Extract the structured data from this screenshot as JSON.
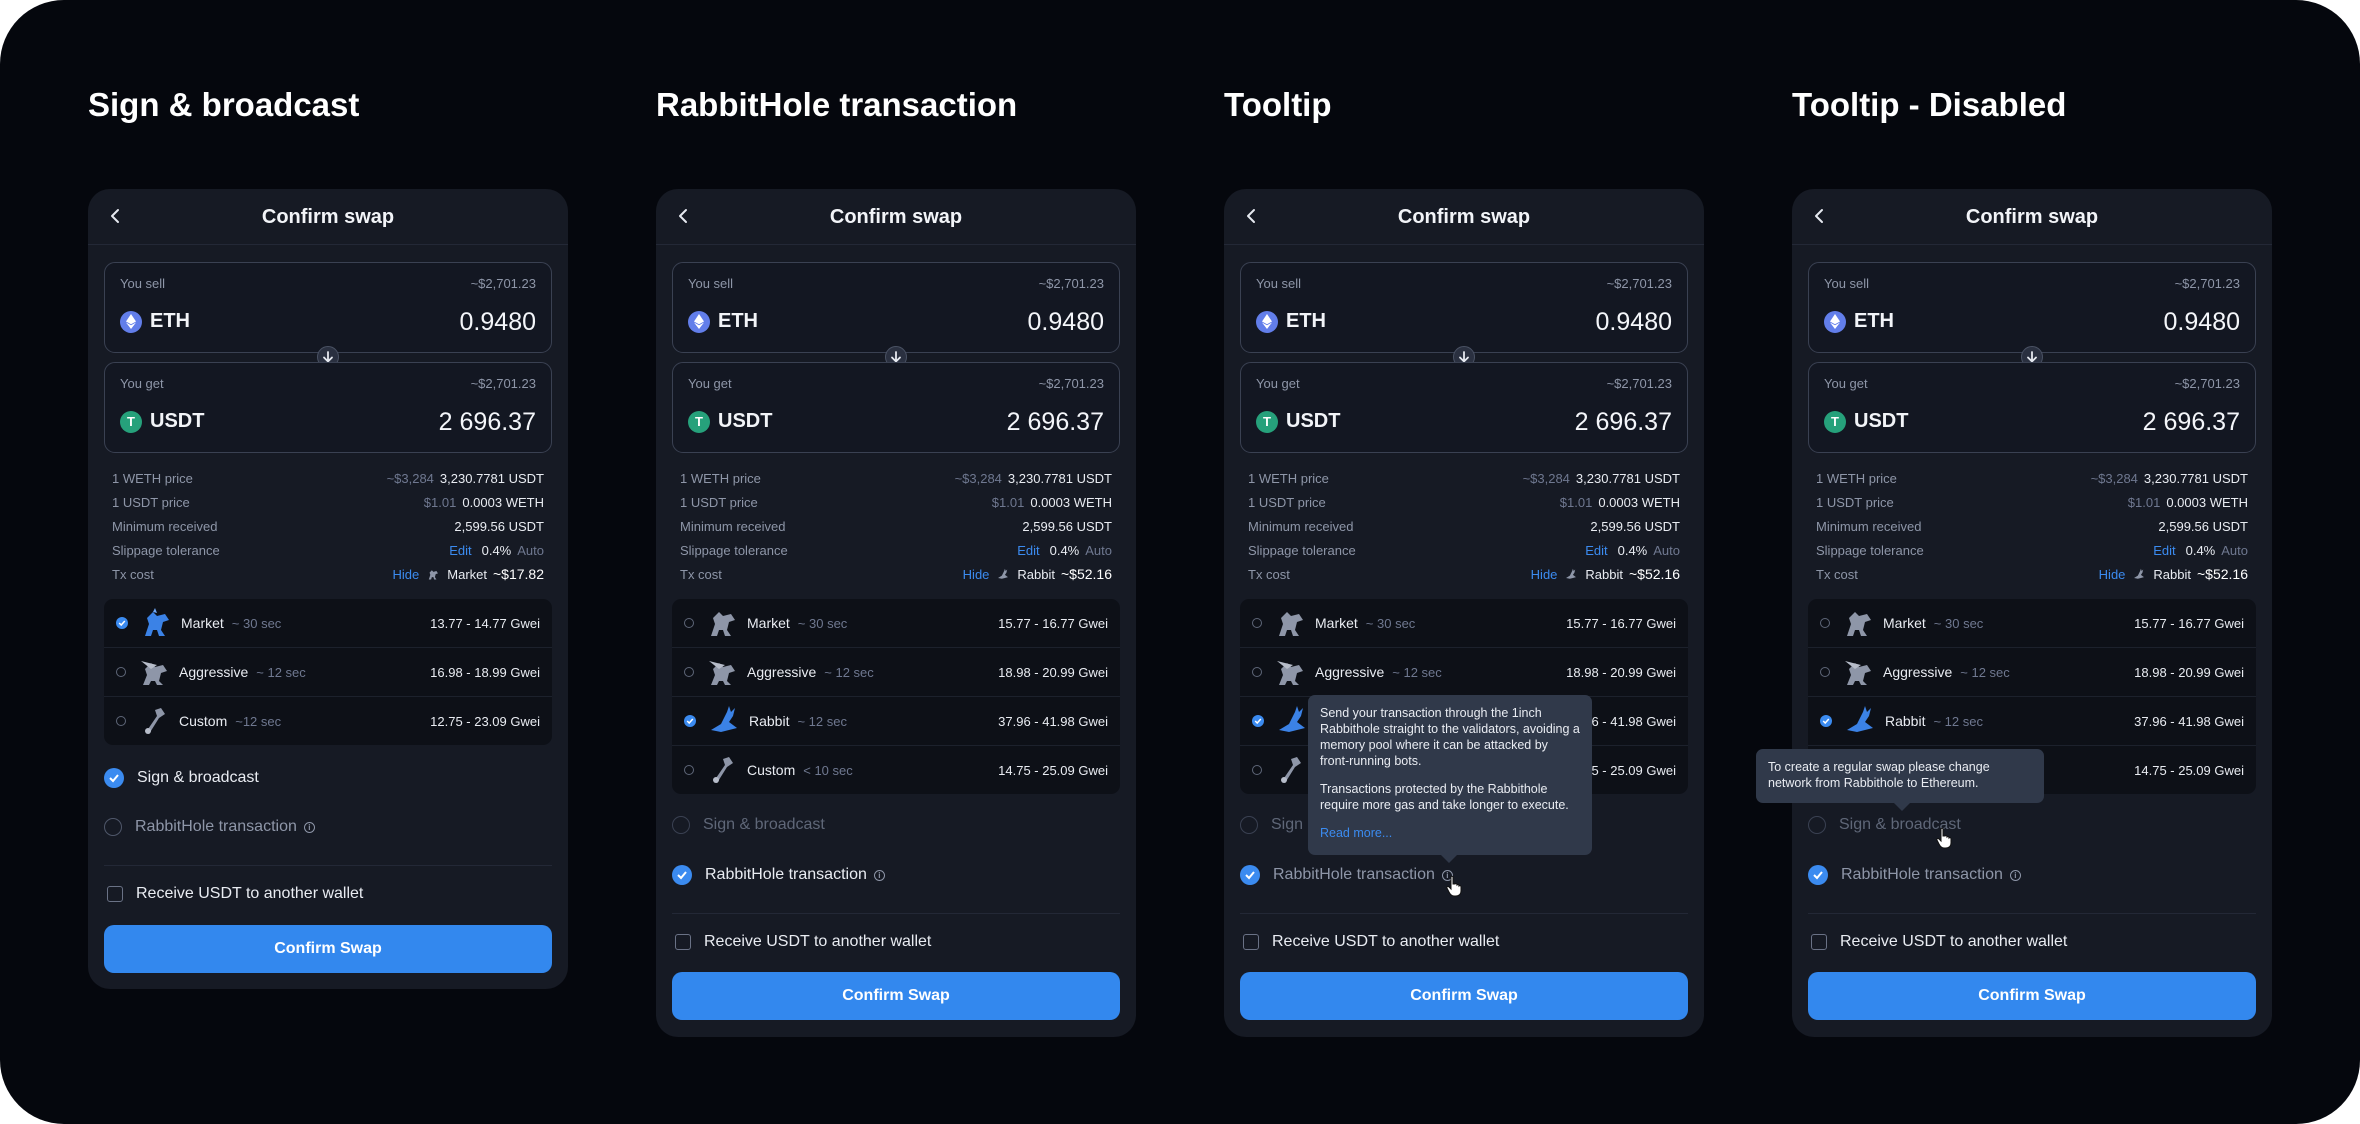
{
  "columns": [
    {
      "title": "Sign & broadcast",
      "header_title": "Confirm swap",
      "sell": {
        "label": "You sell",
        "usd": "~$2,701.23",
        "token": "ETH",
        "amount": "0.9480"
      },
      "get": {
        "label": "You get",
        "usd": "~$2,701.23",
        "token": "USDT",
        "amount": "2 696.37"
      },
      "details": {
        "weth_label": "1 WETH price",
        "weth_usd": "~$3,284",
        "weth_val": "3,230.7781 USDT",
        "usdt_label": "1 USDT price",
        "usdt_usd": "$1.01",
        "usdt_val": "0.0003 WETH",
        "min_label": "Minimum received",
        "min_val": "2,599.56 USDT",
        "slip_label": "Slippage tolerance",
        "slip_edit": "Edit",
        "slip_val": "0.4%",
        "slip_auto": "Auto",
        "tx_label": "Tx cost",
        "tx_hide": "Hide",
        "tx_mode": "Market",
        "tx_val": "~$17.82"
      },
      "gas": [
        {
          "name": "Market",
          "time": "~ 30 sec",
          "price": "13.77 - 14.77 Gwei",
          "selected": true,
          "icon": "horse-icon"
        },
        {
          "name": "Aggressive",
          "time": "~ 12 sec",
          "price": "16.98 - 18.99 Gwei",
          "selected": false,
          "icon": "pegasus-icon"
        },
        {
          "name": "Custom",
          "time": "~12 sec",
          "price": "12.75 - 23.09 Gwei",
          "selected": false,
          "icon": "wrench-icon"
        }
      ],
      "option_sign": "Sign & broadcast",
      "option_rabbit": "RabbitHole transaction",
      "receive_label": "Receive USDT to another wallet",
      "cta": "Confirm Swap"
    },
    {
      "title": "RabbitHole transaction",
      "header_title": "Confirm swap",
      "sell": {
        "label": "You sell",
        "usd": "~$2,701.23",
        "token": "ETH",
        "amount": "0.9480"
      },
      "get": {
        "label": "You get",
        "usd": "~$2,701.23",
        "token": "USDT",
        "amount": "2 696.37"
      },
      "details": {
        "weth_label": "1 WETH price",
        "weth_usd": "~$3,284",
        "weth_val": "3,230.7781 USDT",
        "usdt_label": "1 USDT price",
        "usdt_usd": "$1.01",
        "usdt_val": "0.0003 WETH",
        "min_label": "Minimum received",
        "min_val": "2,599.56 USDT",
        "slip_label": "Slippage tolerance",
        "slip_edit": "Edit",
        "slip_val": "0.4%",
        "slip_auto": "Auto",
        "tx_label": "Tx cost",
        "tx_hide": "Hide",
        "tx_mode": "Rabbit",
        "tx_val": "~$52.16"
      },
      "gas": [
        {
          "name": "Market",
          "time": "~ 30 sec",
          "price": "15.77 - 16.77 Gwei",
          "selected": false,
          "icon": "horse-icon"
        },
        {
          "name": "Aggressive",
          "time": "~ 12 sec",
          "price": "18.98 - 20.99 Gwei",
          "selected": false,
          "icon": "pegasus-icon"
        },
        {
          "name": "Rabbit",
          "time": "~ 12 sec",
          "price": "37.96 - 41.98 Gwei",
          "selected": true,
          "icon": "rabbit-icon"
        },
        {
          "name": "Custom",
          "time": "< 10 sec",
          "price": "14.75 - 25.09 Gwei",
          "selected": false,
          "icon": "wrench-icon"
        }
      ],
      "option_sign": "Sign & broadcast",
      "option_rabbit": "RabbitHole transaction",
      "receive_label": "Receive USDT to another wallet",
      "cta": "Confirm Swap"
    },
    {
      "title": "Tooltip",
      "header_title": "Confirm swap",
      "sell": {
        "label": "You sell",
        "usd": "~$2,701.23",
        "token": "ETH",
        "amount": "0.9480"
      },
      "get": {
        "label": "You get",
        "usd": "~$2,701.23",
        "token": "USDT",
        "amount": "2 696.37"
      },
      "details": {
        "weth_label": "1 WETH price",
        "weth_usd": "~$3,284",
        "weth_val": "3,230.7781 USDT",
        "usdt_label": "1 USDT price",
        "usdt_usd": "$1.01",
        "usdt_val": "0.0003 WETH",
        "min_label": "Minimum received",
        "min_val": "2,599.56 USDT",
        "slip_label": "Slippage tolerance",
        "slip_edit": "Edit",
        "slip_val": "0.4%",
        "slip_auto": "Auto",
        "tx_label": "Tx cost",
        "tx_hide": "Hide",
        "tx_mode": "Rabbit",
        "tx_val": "~$52.16"
      },
      "gas": [
        {
          "name": "Market",
          "time": "~ 30 sec",
          "price": "15.77 - 16.77 Gwei",
          "selected": false,
          "icon": "horse-icon"
        },
        {
          "name": "Aggressive",
          "time": "~ 12 sec",
          "price": "18.98 - 20.99 Gwei",
          "selected": false,
          "icon": "pegasus-icon"
        },
        {
          "name": "",
          "time": "",
          "price": "6 - 41.98 Gwei",
          "selected": true,
          "icon": "rabbit-icon"
        },
        {
          "name": "",
          "time": "",
          "price": "5 - 25.09 Gwei",
          "selected": false,
          "icon": "wrench-icon"
        }
      ],
      "option_sign": "Sign",
      "option_rabbit": "RabbitHole transaction",
      "receive_label": "Receive USDT to another wallet",
      "cta": "Confirm Swap",
      "tooltip": {
        "p1": "Send your transaction through the 1inch Rabbithole straight to the validators, avoiding a memory pool where it can be attacked by front-running bots.",
        "p2": "Transactions protected by the Rabbithole require more gas and take longer to execute.",
        "read_more": "Read more..."
      }
    },
    {
      "title": "Tooltip - Disabled",
      "header_title": "Confirm swap",
      "sell": {
        "label": "You sell",
        "usd": "~$2,701.23",
        "token": "ETH",
        "amount": "0.9480"
      },
      "get": {
        "label": "You get",
        "usd": "~$2,701.23",
        "token": "USDT",
        "amount": "2 696.37"
      },
      "details": {
        "weth_label": "1 WETH price",
        "weth_usd": "~$3,284",
        "weth_val": "3,230.7781 USDT",
        "usdt_label": "1 USDT price",
        "usdt_usd": "$1.01",
        "usdt_val": "0.0003 WETH",
        "min_label": "Minimum received",
        "min_val": "2,599.56 USDT",
        "slip_label": "Slippage tolerance",
        "slip_edit": "Edit",
        "slip_val": "0.4%",
        "slip_auto": "Auto",
        "tx_label": "Tx cost",
        "tx_hide": "Hide",
        "tx_mode": "Rabbit",
        "tx_val": "~$52.16"
      },
      "gas": [
        {
          "name": "Market",
          "time": "~ 30 sec",
          "price": "15.77 - 16.77 Gwei",
          "selected": false,
          "icon": "horse-icon"
        },
        {
          "name": "Aggressive",
          "time": "~ 12 sec",
          "price": "18.98 - 20.99 Gwei",
          "selected": false,
          "icon": "pegasus-icon"
        },
        {
          "name": "Rabbit",
          "time": "~ 12 sec",
          "price": "37.96 - 41.98 Gwei",
          "selected": true,
          "icon": "rabbit-icon"
        },
        {
          "name": "",
          "time": "",
          "price": "14.75 - 25.09 Gwei",
          "selected": false,
          "icon": "wrench-icon"
        }
      ],
      "option_sign": "Sign & broadcast",
      "option_rabbit": "RabbitHole transaction",
      "receive_label": "Receive USDT to another wallet",
      "cta": "Confirm Swap",
      "tooltip": {
        "p1": "To create a regular swap please change network from Rabbithole to Ethereum."
      }
    }
  ]
}
